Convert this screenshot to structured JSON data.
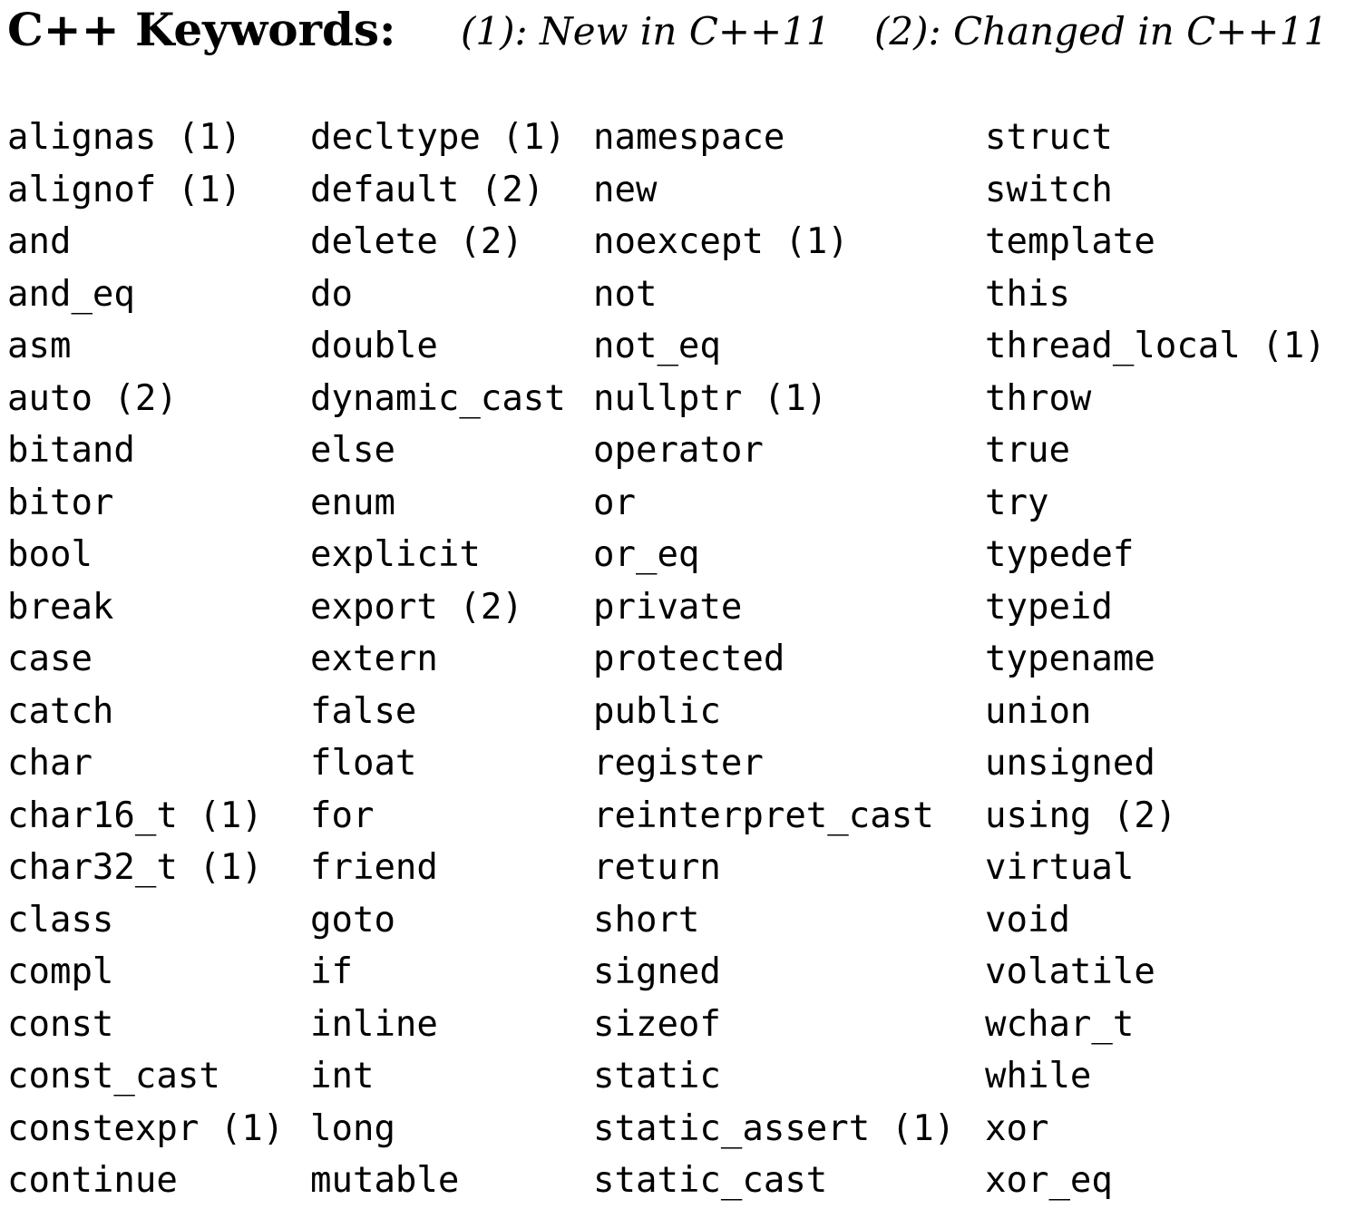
{
  "header": {
    "title": "C++ Keywords:",
    "legend_new": "(1): New in C++11",
    "legend_changed": "(2): Changed in C++11"
  },
  "columns": [
    [
      "alignas (1)",
      "alignof (1)",
      "and",
      "and_eq",
      "asm",
      "auto (2)",
      "bitand",
      "bitor",
      "bool",
      "break",
      "case",
      "catch",
      "char",
      "char16_t (1)",
      "char32_t (1)",
      "class",
      "compl",
      "const",
      "const_cast",
      "constexpr (1)",
      "continue"
    ],
    [
      "decltype (1)",
      "default (2)",
      "delete (2)",
      "do",
      "double",
      "dynamic_cast",
      "else",
      "enum",
      "explicit",
      "export (2)",
      "extern",
      "false",
      "float",
      "for",
      "friend",
      "goto",
      "if",
      "inline",
      "int",
      "long",
      "mutable"
    ],
    [
      "namespace",
      "new",
      "noexcept (1)",
      "not",
      "not_eq",
      "nullptr (1)",
      "operator",
      "or",
      "or_eq",
      "private",
      "protected",
      "public",
      "register",
      "reinterpret_cast",
      "return",
      "short",
      "signed",
      "sizeof",
      "static",
      "static_assert (1)",
      "static_cast"
    ],
    [
      "struct",
      "switch",
      "template",
      "this",
      "thread_local (1)",
      "throw",
      "true",
      "try",
      "typedef",
      "typeid",
      "typename",
      "union",
      "unsigned",
      "using (2)",
      "virtual",
      "void",
      "volatile",
      "wchar_t",
      "while",
      "xor",
      "xor_eq"
    ]
  ]
}
